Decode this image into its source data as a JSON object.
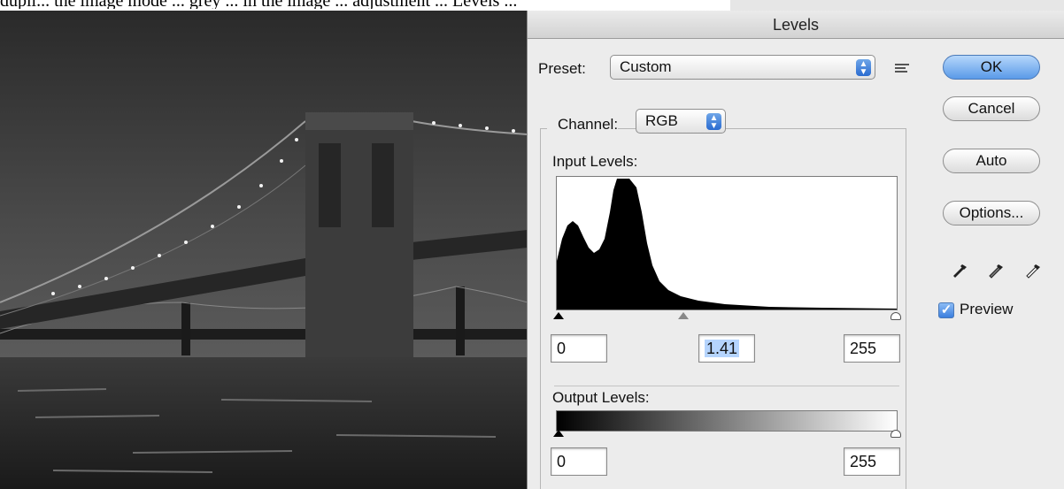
{
  "caption": "dupli... the image mode ... grey ... in the image ... adjustment ... Levels ...",
  "dialog": {
    "title": "Levels",
    "preset_label": "Preset:",
    "preset_value": "Custom",
    "channel_label": "Channel:",
    "channel_value": "RGB",
    "input_levels_label": "Input Levels:",
    "input_black": "0",
    "input_gamma": "1.41",
    "input_white": "255",
    "output_levels_label": "Output Levels:",
    "output_black": "0",
    "output_white": "255",
    "buttons": {
      "ok": "OK",
      "cancel": "Cancel",
      "auto": "Auto",
      "options": "Options..."
    },
    "preview_label": "Preview",
    "preview_checked": true,
    "accent_color": "#3b7ede"
  },
  "icons": {
    "preset_menu": "preset-menu-icon",
    "eyedroppers": [
      "black-eyedropper-icon",
      "gray-eyedropper-icon",
      "white-eyedropper-icon"
    ]
  }
}
